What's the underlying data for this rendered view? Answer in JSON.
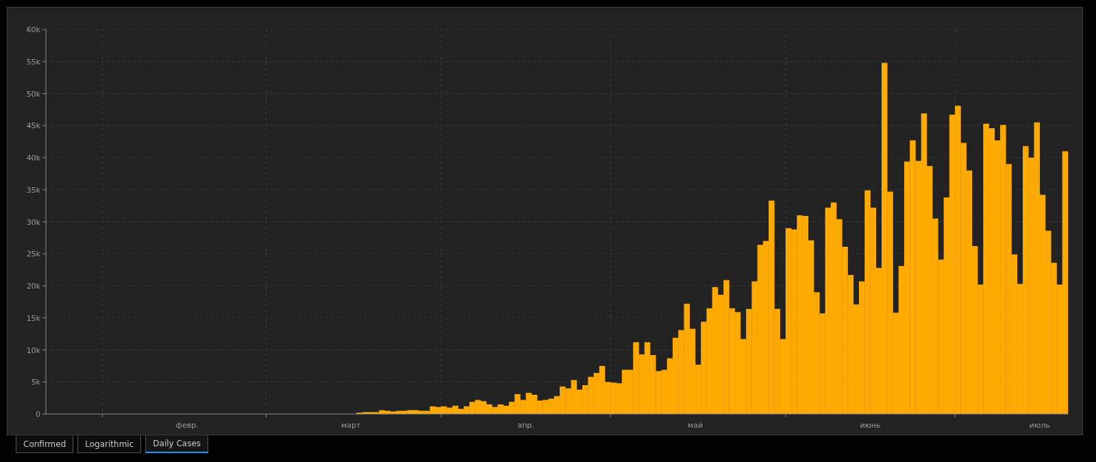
{
  "chart": {
    "chart_data": {
      "type": "bar",
      "grid": true,
      "categories": [
        null,
        null,
        null,
        null,
        null,
        null,
        null,
        null,
        null,
        null,
        null,
        null,
        null,
        null,
        null,
        null,
        null,
        null,
        null,
        null,
        null,
        null,
        null,
        null,
        null,
        "февр.",
        null,
        null,
        null,
        null,
        null,
        null,
        null,
        null,
        null,
        null,
        null,
        null,
        null,
        null,
        null,
        null,
        null,
        null,
        null,
        null,
        null,
        null,
        null,
        null,
        null,
        null,
        null,
        null,
        "март",
        null,
        null,
        null,
        null,
        null,
        null,
        null,
        null,
        null,
        null,
        null,
        null,
        null,
        null,
        null,
        null,
        null,
        null,
        null,
        null,
        null,
        null,
        null,
        null,
        null,
        null,
        null,
        null,
        null,
        null,
        "апр.",
        null,
        null,
        null,
        null,
        null,
        null,
        null,
        null,
        null,
        null,
        null,
        null,
        null,
        null,
        null,
        null,
        null,
        null,
        null,
        null,
        null,
        null,
        null,
        null,
        null,
        null,
        null,
        null,
        null,
        "май",
        null,
        null,
        null,
        null,
        null,
        null,
        null,
        null,
        null,
        null,
        null,
        null,
        null,
        null,
        null,
        null,
        null,
        null,
        null,
        null,
        null,
        null,
        null,
        null,
        null,
        null,
        null,
        null,
        null,
        null,
        "июнь",
        null,
        null,
        null,
        null,
        null,
        null,
        null,
        null,
        null,
        null,
        null,
        null,
        null,
        null,
        null,
        null,
        null,
        null,
        null,
        null,
        null,
        null,
        null,
        null,
        null,
        null,
        null,
        null,
        null,
        "июль",
        null,
        null,
        null,
        null
      ],
      "series": [
        {
          "color": "#ffaa00",
          "values": [
            0,
            0,
            0,
            0,
            0,
            0,
            0,
            0,
            0,
            0,
            0,
            0,
            0,
            0,
            0,
            0,
            0,
            0,
            0,
            0,
            0,
            0,
            0,
            0,
            0,
            0,
            0,
            0,
            0,
            0,
            0,
            0,
            0,
            0,
            0,
            0,
            0,
            0,
            0,
            0,
            0,
            0,
            0,
            0,
            0,
            0,
            0,
            0,
            0,
            0,
            null,
            0,
            0,
            null,
            null,
            200,
            300,
            300,
            300,
            600,
            500,
            400,
            500,
            500,
            600,
            600,
            500,
            500,
            1200,
            1100,
            1200,
            1000,
            1300,
            800,
            1200,
            1900,
            2200,
            2000,
            1500,
            1100,
            1500,
            1300,
            1900,
            3100,
            2200,
            3300,
            3000,
            2100,
            2200,
            2400,
            2800,
            4300,
            4000,
            5300,
            3800,
            4500,
            5800,
            6400,
            7500,
            5000,
            4900,
            4800,
            6900,
            6900,
            11200,
            9300,
            11200,
            9200,
            6700,
            6900,
            8700,
            11900,
            13100,
            17200,
            13300,
            7700,
            14400,
            16500,
            19800,
            18600,
            20900,
            16500,
            15900,
            11700,
            16400,
            20700,
            26400,
            27000,
            33300,
            16400,
            11700,
            29000,
            28800,
            31000,
            30900,
            27100,
            19000,
            15700,
            32200,
            33000,
            30400,
            26100,
            21700,
            17100,
            20700,
            34900,
            32200,
            22800,
            54800,
            34700,
            15800,
            23100,
            39400,
            42700,
            39500,
            46900,
            38700,
            30500,
            24100,
            33800,
            46700,
            48100,
            42300,
            38000,
            26200,
            20200,
            45300,
            44600,
            42700,
            45100,
            39000,
            24900,
            20300,
            41800,
            40000,
            45500,
            34200,
            28600,
            23600,
            20200,
            41000
          ]
        }
      ],
      "ylim": [
        0,
        60000
      ],
      "yticks": [
        {
          "value": 0,
          "label": "0"
        },
        {
          "value": 5000,
          "label": "5k"
        },
        {
          "value": 10000,
          "label": "10k"
        },
        {
          "value": 15000,
          "label": "15k"
        },
        {
          "value": 20000,
          "label": "20k"
        },
        {
          "value": 25000,
          "label": "25k"
        },
        {
          "value": 30000,
          "label": "30k"
        },
        {
          "value": 35000,
          "label": "35k"
        },
        {
          "value": 40000,
          "label": "40k"
        },
        {
          "value": 45000,
          "label": "45k"
        },
        {
          "value": 50000,
          "label": "50k"
        },
        {
          "value": 55000,
          "label": "55k"
        },
        {
          "value": 60000,
          "label": "60k"
        }
      ]
    }
  },
  "tabs": [
    {
      "label": "Confirmed",
      "selected": false
    },
    {
      "label": "Logarithmic",
      "selected": false
    },
    {
      "label": "Daily Cases",
      "selected": true
    }
  ]
}
